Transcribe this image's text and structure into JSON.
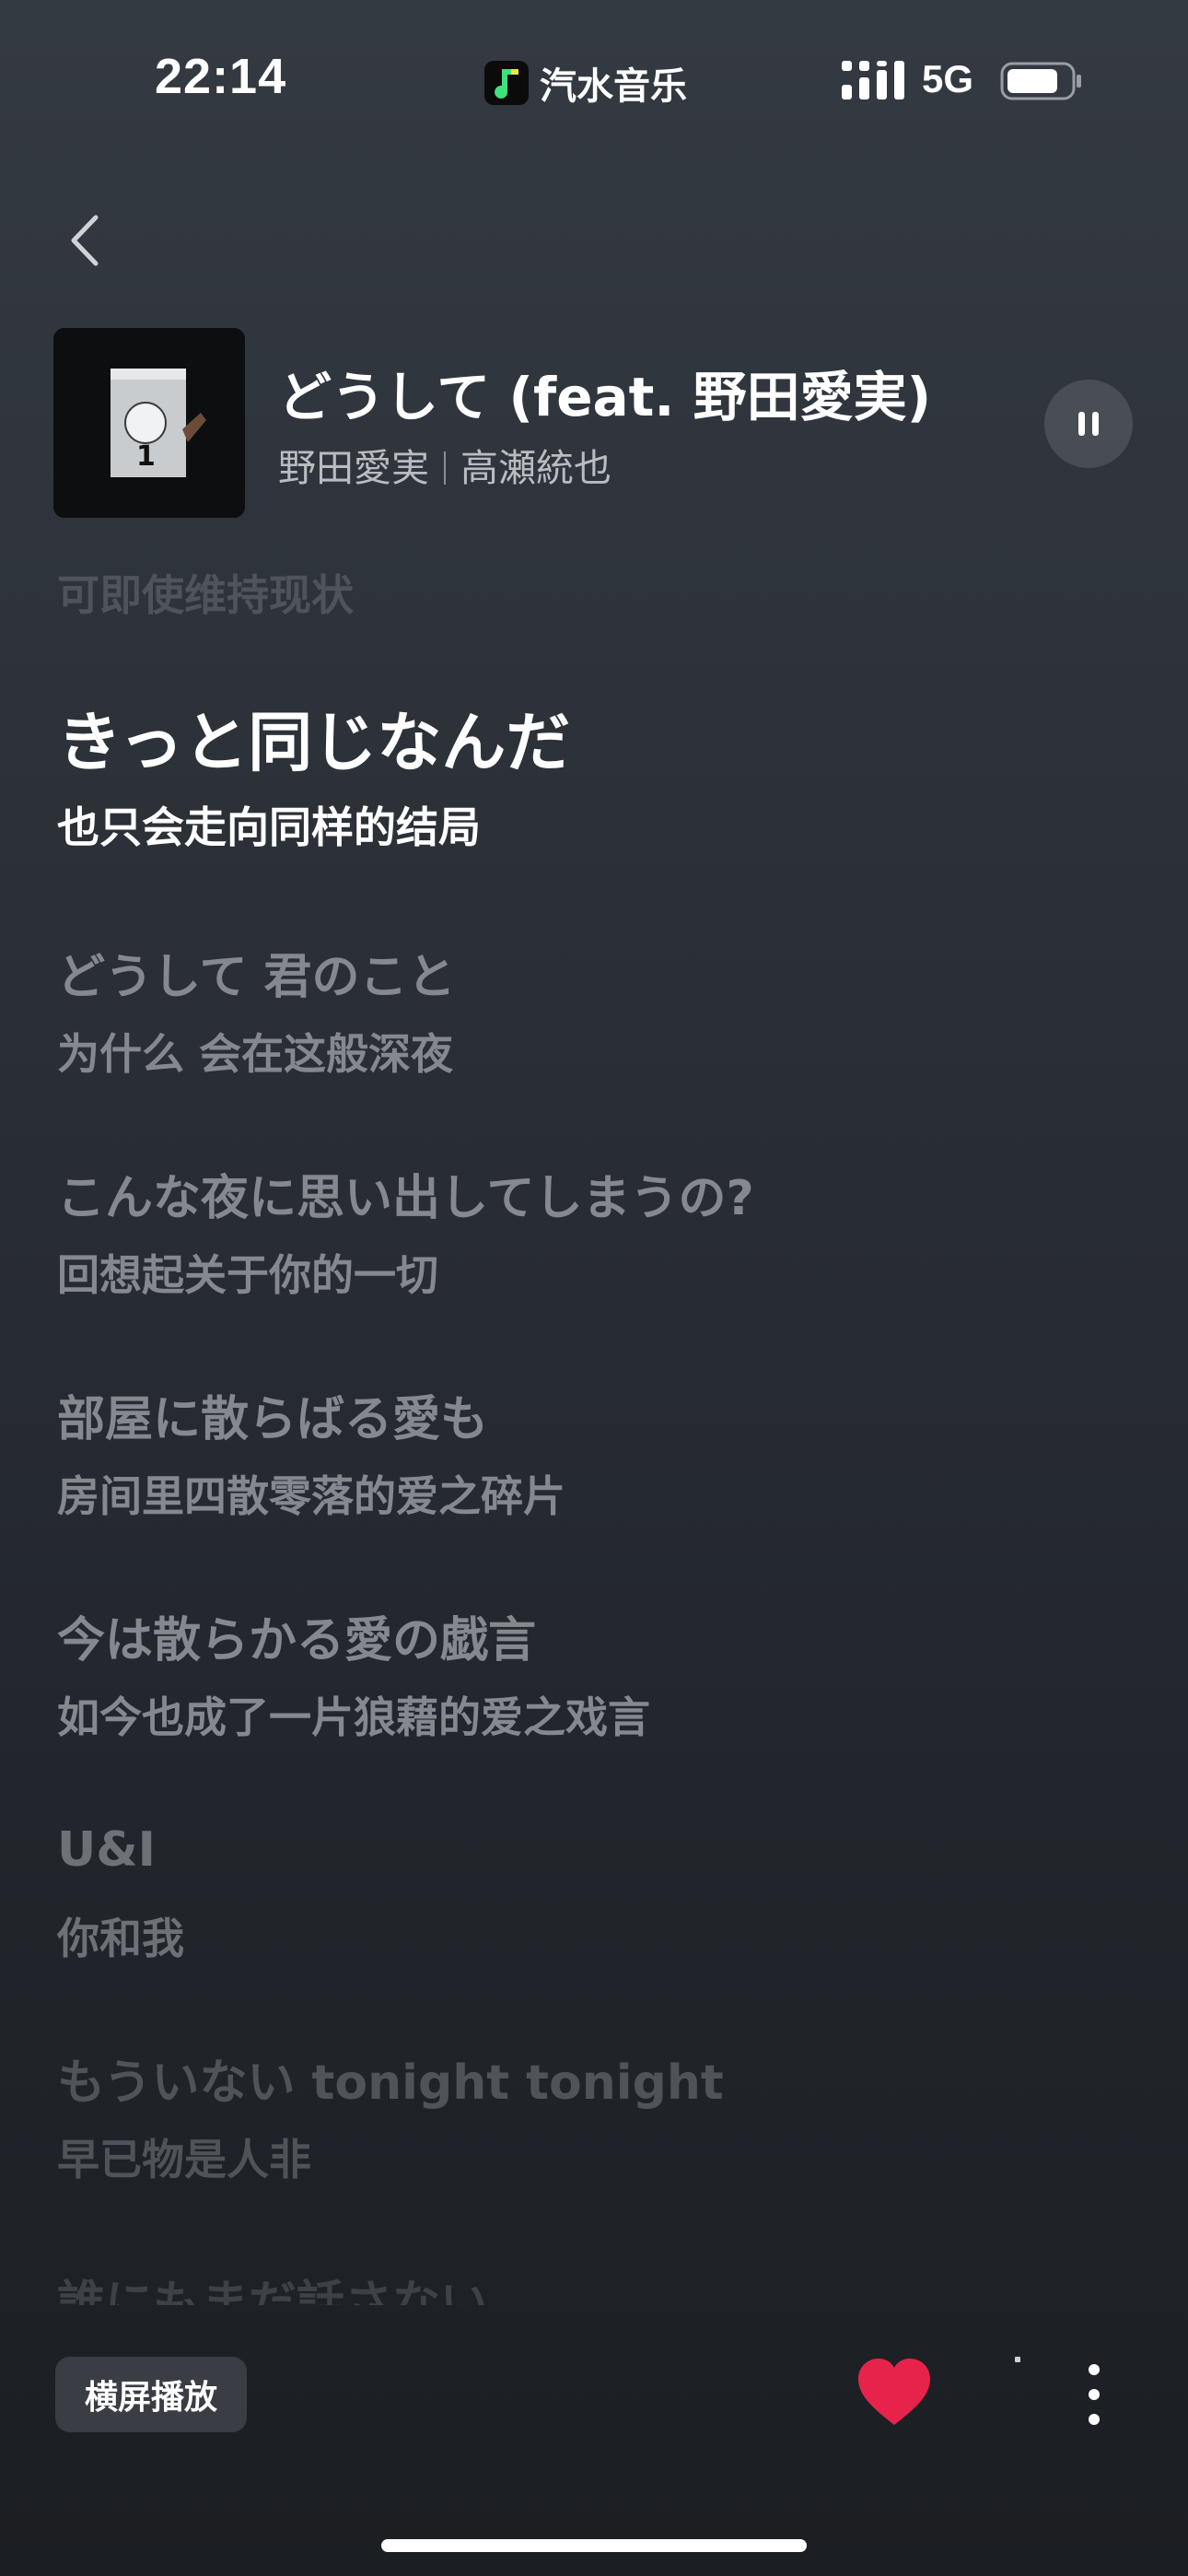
{
  "status_bar": {
    "time": "22:14",
    "app_name": "汽水音乐",
    "network": "5G"
  },
  "now_playing": {
    "title": "どうして (feat. 野田愛実)",
    "artists": [
      "野田愛実",
      "高瀬統也"
    ],
    "album_cover_label": "1",
    "state": "playing"
  },
  "lyrics": [
    {
      "zh": "可即使维持现状",
      "state": "past"
    },
    {
      "ja": "きっと同じなんだ",
      "zh": "也只会走向同样的结局",
      "state": "current"
    },
    {
      "ja": "どうして 君のこと",
      "zh": "为什么 会在这般深夜",
      "state": "upcoming"
    },
    {
      "ja": "こんな夜に思い出してしまうの?",
      "zh": "回想起关于你的一切",
      "state": "upcoming"
    },
    {
      "ja": "部屋に散らばる愛も",
      "zh": "房间里四散零落的爱之碎片",
      "state": "upcoming"
    },
    {
      "ja": "今は散らかる愛の戯言",
      "zh": "如今也成了一片狼藉的爱之戏言",
      "state": "upcoming"
    },
    {
      "ja": "U&I",
      "zh": "你和我",
      "state": "upcoming"
    },
    {
      "ja": "もういない tonight tonight",
      "zh": "早已物是人非",
      "state": "fading"
    },
    {
      "ja": "誰にもまだ話さない",
      "state": "fading"
    }
  ],
  "bottom_bar": {
    "landscape_label": "横屏播放",
    "liked": true
  },
  "colors": {
    "like": "#e8234b",
    "lyric_inactive": "#85898f",
    "lyric_active": "#ffffff"
  }
}
